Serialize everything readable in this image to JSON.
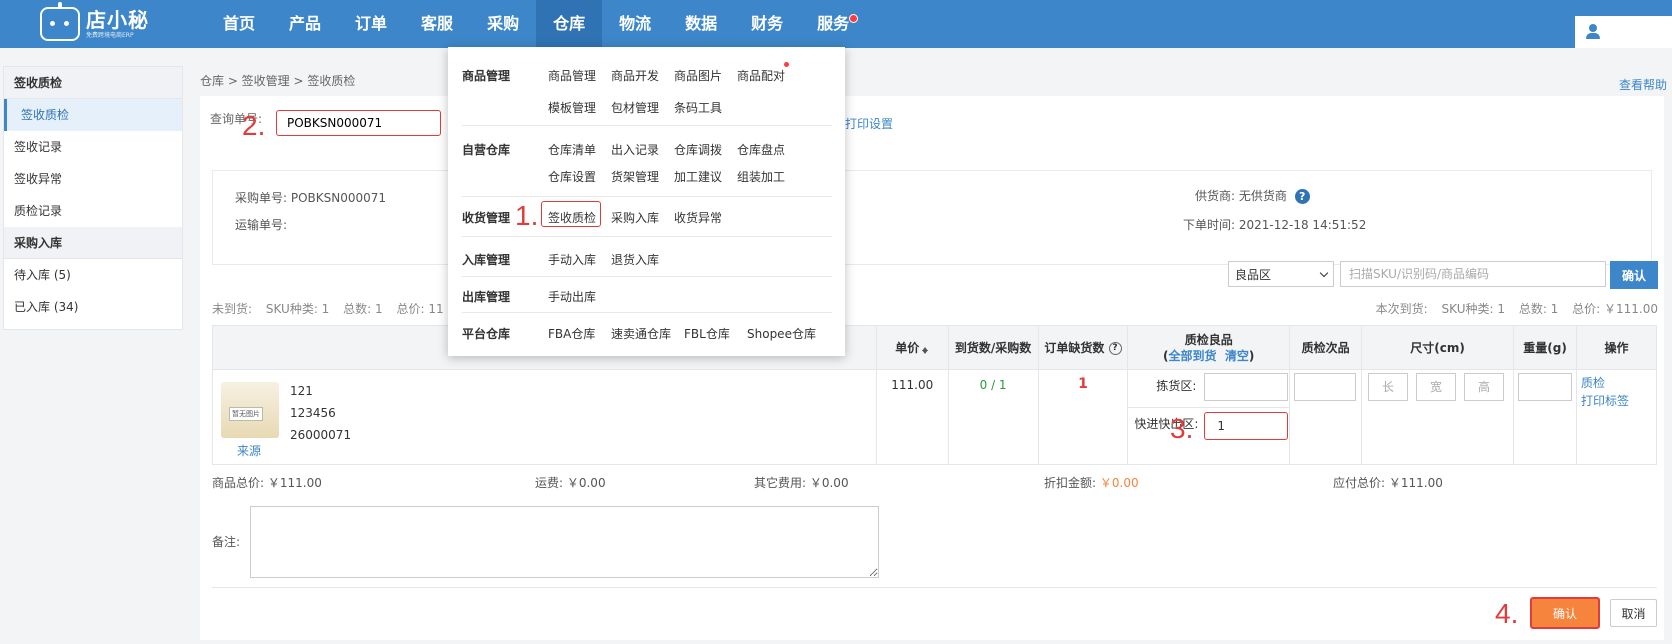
{
  "header": {
    "logo_name": "店小秘",
    "logo_sub": "免费跨境电商ERP",
    "nav": [
      "首页",
      "产品",
      "订单",
      "客服",
      "采购",
      "仓库",
      "物流",
      "数据",
      "财务",
      "服务"
    ],
    "active_nav": "仓库"
  },
  "sidebar": {
    "groups": [
      {
        "title": "签收质检",
        "items": [
          "签收质检",
          "签收记录",
          "签收异常",
          "质检记录"
        ]
      },
      {
        "title": "采购入库",
        "items": [
          "待入库 (5)",
          "已入库 (34)"
        ]
      }
    ]
  },
  "breadcrumb": "仓库 > 签收管理 > 签收质检",
  "help_link": "查看帮助",
  "query": {
    "label": "查询单号:",
    "value": "POBKSN000071"
  },
  "print_settings": "打印设置",
  "info": {
    "po_label": "采购单号:",
    "po_value": "POBKSN000071",
    "ship_label": "运输单号:",
    "ship_value": "",
    "supplier_label": "供货商:",
    "supplier_value": "无供货商",
    "order_time_label": "下单时间:",
    "order_time_value": "2021-12-18 14:51:52"
  },
  "zone_select": "良品区",
  "scan_placeholder": "扫描SKU/识别码/商品编码",
  "scan_confirm": "确认",
  "summary_left": [
    "未到货:",
    "SKU种类: 1",
    "总数: 1",
    "总价: 11"
  ],
  "summary_right": [
    "本次到货:",
    "SKU种类: 1",
    "总数: 1",
    "总价: ￥111.00"
  ],
  "table": {
    "headers": {
      "price": "单价",
      "arrived": "到货数/采购数",
      "shortage": "订单缺货数",
      "qc_good": "质检良品",
      "all_arrived": "全部到货",
      "clear": "清空",
      "qc_bad": "质检次品",
      "size": "尺寸(cm)",
      "weight": "重量(g)",
      "action": "操作"
    },
    "row": {
      "img_label": "暂无图片",
      "source": "来源",
      "line1": "121",
      "line2": "123456",
      "line3": "26000071",
      "price": "111.00",
      "arrived": "0 / 1",
      "shortage": "1",
      "pick_label": "拣货区:",
      "fast_label": "快进快出区:",
      "fast_value": "1",
      "len": "长",
      "wid": "宽",
      "hei": "高",
      "qc_link": "质检",
      "print_label": "打印标签"
    }
  },
  "totals": {
    "goods": "商品总价: ￥111.00",
    "freight": "运费: ￥0.00",
    "other": "其它费用: ￥0.00",
    "discount_label": "折扣金额:",
    "discount_value": "￥0.00",
    "payable": "应付总价: ￥111.00"
  },
  "remark_label": "备注:",
  "confirm": "确认",
  "cancel": "取消",
  "steps": [
    "1.",
    "2.",
    "3.",
    "4."
  ],
  "dropdown": {
    "sections": [
      {
        "cat": "商品管理",
        "items": [
          "商品管理",
          "商品开发",
          "商品图片",
          "商品配对",
          "模板管理",
          "包材管理",
          "条码工具"
        ]
      },
      {
        "cat": "自营仓库",
        "items": [
          "仓库清单",
          "出入记录",
          "仓库调拨",
          "仓库盘点",
          "仓库设置",
          "货架管理",
          "加工建议",
          "组装加工"
        ]
      },
      {
        "cat": "收货管理",
        "items": [
          "签收质检",
          "采购入库",
          "收货异常"
        ]
      },
      {
        "cat": "入库管理",
        "items": [
          "手动入库",
          "退货入库"
        ]
      },
      {
        "cat": "出库管理",
        "items": [
          "手动出库"
        ]
      },
      {
        "cat": "平台仓库",
        "items": [
          "FBA仓库",
          "速卖通仓库",
          "FBL仓库",
          "Shopee仓库"
        ]
      }
    ]
  },
  "colors": {
    "brand": "#3d86c9",
    "annotation": "#e23b3b",
    "confirm": "#f6843c"
  }
}
